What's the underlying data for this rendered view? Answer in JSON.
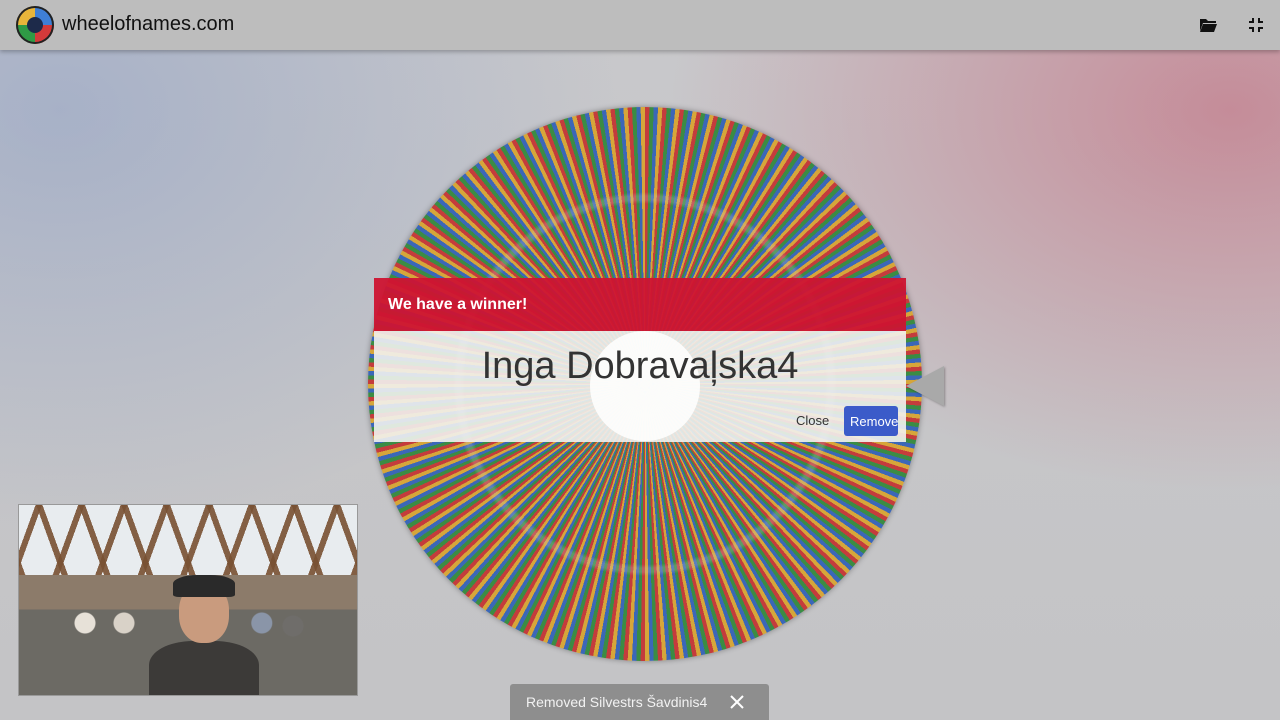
{
  "topbar": {
    "site_name": "wheelofnames.com",
    "icons": [
      "open-folder-icon",
      "exit-fullscreen-icon"
    ]
  },
  "dialog": {
    "title": "We have a winner!",
    "winner_name": "Inga Dobravaļska4",
    "close_label": "Close",
    "remove_label": "Remove",
    "header_color": "#cd1432",
    "remove_color": "#3b5bc9"
  },
  "snackbar": {
    "message": "Removed Silvestrs Šavdinis4"
  }
}
